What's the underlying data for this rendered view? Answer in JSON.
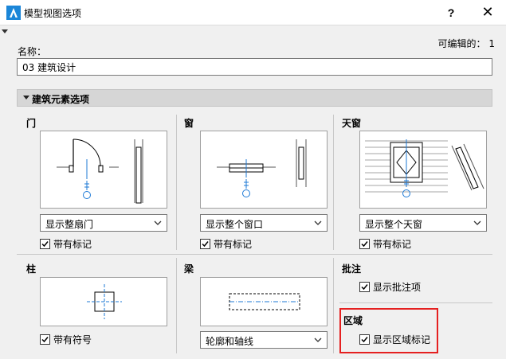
{
  "window": {
    "title": "模型视图选项",
    "help_glyph": "?",
    "close_glyph": "✕"
  },
  "name_label": "名称：",
  "editable_label": "可编辑的： 1",
  "name_value": "03 建筑设计",
  "section_title": "建筑元素选项",
  "door": {
    "title": "门",
    "dropdown_value": "显示整扇门",
    "checkbox_label": "带有标记",
    "checked": true
  },
  "window_group": {
    "title": "窗",
    "dropdown_value": "显示整个窗口",
    "checkbox_label": "带有标记",
    "checked": true
  },
  "skylight": {
    "title": "天窗",
    "dropdown_value": "显示整个天窗",
    "checkbox_label": "带有标记",
    "checked": true
  },
  "column": {
    "title": "柱",
    "checkbox_label": "带有符号",
    "checked": true
  },
  "beam": {
    "title": "梁",
    "dropdown_value": "轮廓和轴线"
  },
  "annotation": {
    "title": "批注",
    "checkbox_label": "显示批注项",
    "checked": true
  },
  "zone": {
    "title": "区域",
    "checkbox_label": "显示区域标记",
    "checked": true
  },
  "colors": {
    "accent_blue": "#1e7ad6",
    "highlight_red": "#e52020"
  }
}
